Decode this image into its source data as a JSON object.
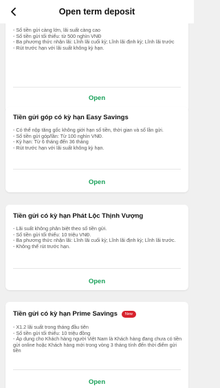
{
  "header": {
    "title": "Open term deposit"
  },
  "cards": [
    {
      "title": "",
      "lines": [
        "- Số tiền gửi càng lớn, lãi suất càng cao",
        "- Số tiền gửi tối thiểu: từ 500 nghìn VNĐ",
        "- Ba phương thức nhận lãi: Lĩnh lãi cuối kỳ; Lĩnh lãi định kỳ; Lĩnh lãi trước",
        "- Rút trước hạn với lãi suất không kỳ hạn."
      ],
      "action": "Open"
    },
    {
      "title": "Tiền gửi góp có kỳ hạn Easy Savings",
      "lines": [
        "- Có thể nộp tăng gốc không giới hạn số tiền, thời gian và số lần gửi.",
        "- Số tiền gửi góp/lần: Từ 100 nghìn VNĐ.",
        "- Kỳ hạn: Từ 6 tháng đến 36 tháng",
        "- Rút trước hạn với lãi suất không kỳ hạn."
      ],
      "action": "Open"
    },
    {
      "title": "Tiền gửi có kỳ hạn Phát Lộc Thịnh Vượng",
      "lines": [
        "- Lãi suất không phân biệt theo số tiền gửi.",
        "- Số tiền gửi tối thiểu: 10 triệu VNĐ.",
        "- Ba phương thức nhận lãi: Lĩnh lãi cuối kỳ; Lĩnh lãi định kỳ; Lĩnh lãi trước.",
        "- Không thể rút trước hạn."
      ],
      "action": "Open"
    },
    {
      "title": "Tiền gửi có kỳ hạn Prime Savings",
      "badge": "New",
      "lines": [
        "- X1.2 lãi suất trong tháng đầu tiên",
        "- Số tiền gửi tối thiểu: 10 triệu đồng",
        "- Áp dụng cho Khách hàng người Việt Nam là Khách hàng đang chưa có tiền gửi online hoặc Khách hàng mới trong vòng 3 tháng tính đến thời điểm gửi tiền"
      ],
      "action": "Open"
    }
  ],
  "colors": {
    "accent": "#1aa15a",
    "badge": "#d7232e",
    "background": "#f0f0f0"
  },
  "icons": {
    "back": "chevron-left-icon"
  }
}
